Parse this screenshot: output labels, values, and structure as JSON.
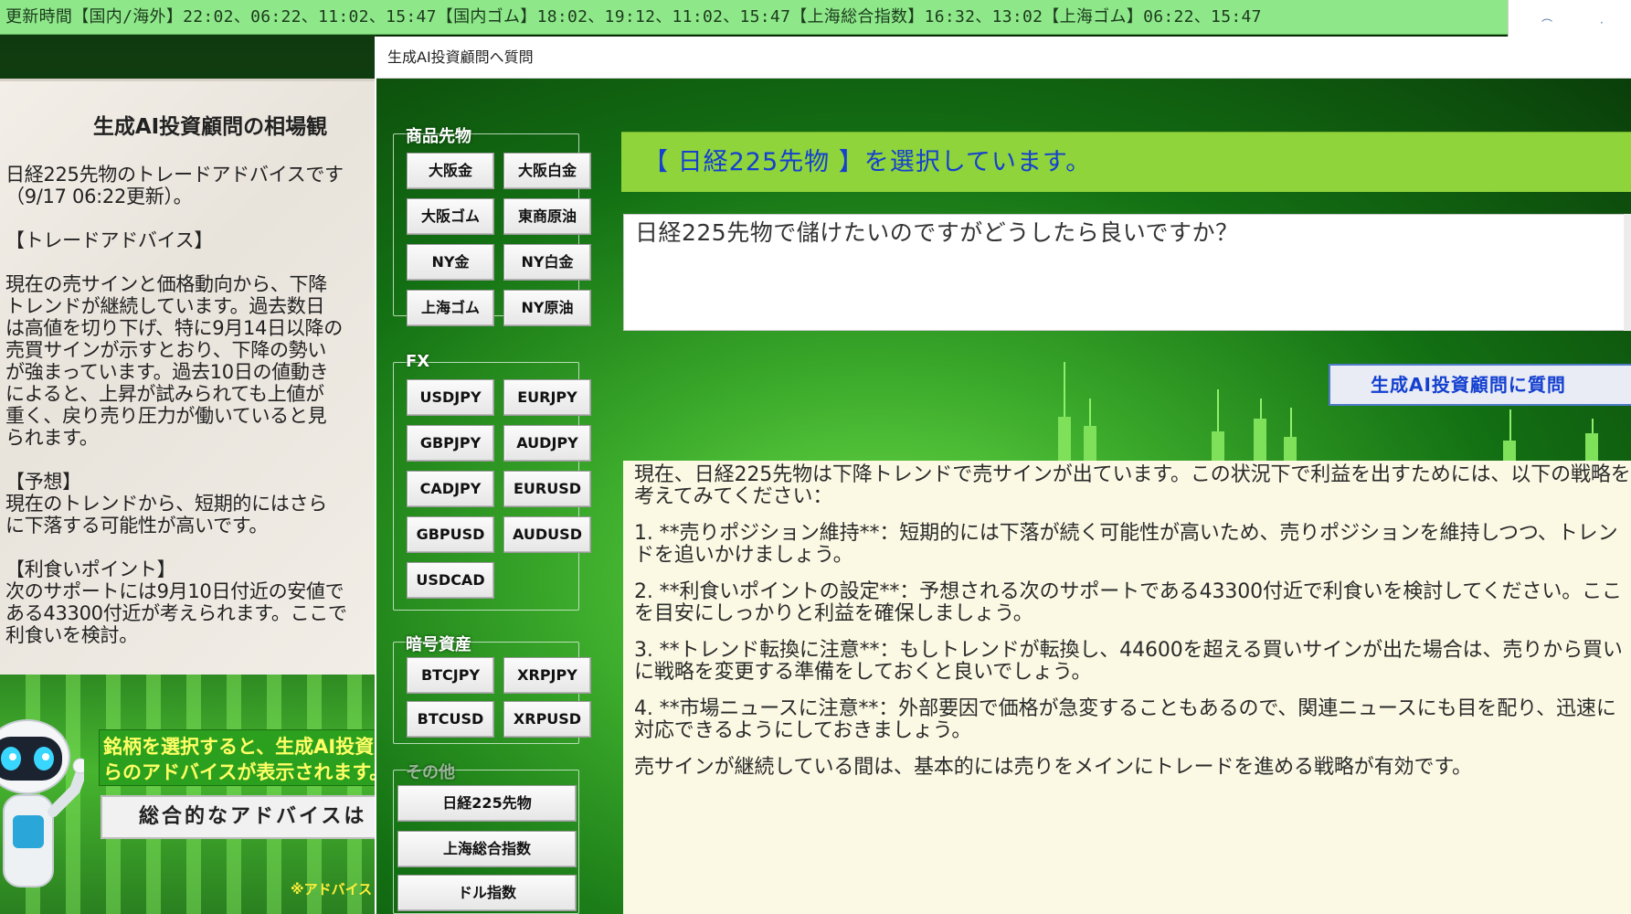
{
  "ticker": {
    "text": "更新時間【国内/海外】22:02、06:22、11:02、15:47【国内ゴム】18:02、19:12、11:02、15:47【上海総合指数】16:32、13:02【上海ゴム】06:22、15:47"
  },
  "background_app": {
    "title": "生成AI投資顧問の相場観",
    "body": "日経225先物のトレードアドバイスです\n（9/17 06:22更新）。\n\n【トレードアドバイス】\n\n現在の売サインと価格動向から、下降\nトレンドが継続しています。過去数日\nは高値を切り下げ、特に9月14日以降の\n売買サインが示すとおり、下降の勢い\nが強まっています。過去10日の値動き\nによると、上昇が試みられても上値が\n重く、戻り売り圧力が働いていると見\nられます。\n\n【予想】\n現在のトレンドから、短期的にはさら\nに下落する可能性が高いです。\n\n【利食いポイント】\n次のサポートには9月10日付近の安値で\nある43300付近が考えられます。ここで\n利食いを検討。",
    "notice": "銘柄を選択すると、生成AI投資顧問か\nらのアドバイスが表示されます。",
    "overall_button": "総合的なアドバイスは",
    "footnote": "※アドバイス"
  },
  "dialog": {
    "title": "生成AI投資顧問へ質問",
    "groups": {
      "commodities": {
        "label": "商品先物",
        "buttons": [
          "大阪金",
          "大阪白金",
          "大阪ゴム",
          "東商原油",
          "NY金",
          "NY白金",
          "上海ゴム",
          "NY原油"
        ]
      },
      "fx": {
        "label": "FX",
        "buttons": [
          "USDJPY",
          "EURJPY",
          "GBPJPY",
          "AUDJPY",
          "CADJPY",
          "EURUSD",
          "GBPUSD",
          "AUDUSD",
          "USDCAD"
        ]
      },
      "crypto": {
        "label": "暗号資産",
        "buttons": [
          "BTCJPY",
          "XRPJPY",
          "BTCUSD",
          "XRPUSD"
        ]
      },
      "other": {
        "label": "その他",
        "buttons": [
          "日経225先物",
          "上海総合指数",
          "ドル指数"
        ]
      }
    },
    "selection_header": "【 日経225先物 】を選択しています。",
    "question": "日経225先物で儲けたいのですがどうしたら良いですか？",
    "ask_button": "生成AI投資顧問に質問",
    "answer": [
      "現在、日経225先物は下降トレンドで売サインが出ています。この状況下で利益を出すためには、以下の戦略を考えてみてください：",
      "1. **売りポジション維持**：短期的には下落が続く可能性が高いため、売りポジションを維持しつつ、トレンドを追いかけましょう。",
      "2. **利食いポイントの設定**：予想される次のサポートである43300付近で利食いを検討してください。ここを目安にしっかりと利益を確保しましょう。",
      "3. **トレンド転換に注意**：もしトレンドが転換し、44600を超える買いサインが出た場合は、売りから買いに戦略を変更する準備をしておくと良いでしょう。",
      "4. **市場ニュースに注意**：外部要因で価格が急変することもあるので、関連ニュースにも目を配り、迅速に対応できるようにしておきましょう。",
      "売サインが継続している間は、基本的には売りをメインにトレードを進める戦略が有効です。"
    ]
  },
  "colors": {
    "ticker_bg": "#8ee88a",
    "header_bg": "#8fd43a",
    "header_text": "#1440d0",
    "answer_bg": "#fbf9e4",
    "notice_text": "#ffff66"
  }
}
